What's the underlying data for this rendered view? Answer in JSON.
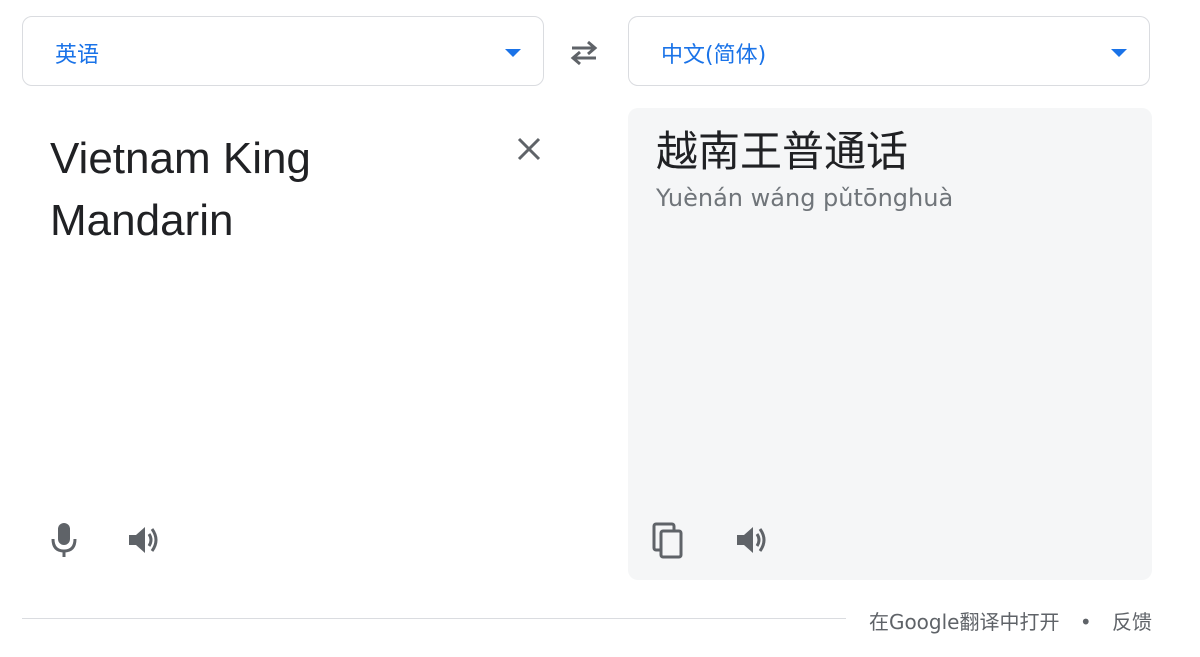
{
  "source_language": {
    "label": "英语"
  },
  "target_language": {
    "label": "中文(简体)"
  },
  "source": {
    "text": "Vietnam King Mandarin"
  },
  "translation": {
    "text": "越南王普通话",
    "romanization": "Yuènán wáng pǔtōnghuà"
  },
  "footer": {
    "open_link": "在Google翻译中打开",
    "separator": "•",
    "feedback_link": "反馈"
  },
  "icons": {
    "dropdown": "caret-down-icon",
    "swap": "swap-icon",
    "clear": "close-icon",
    "microphone": "microphone-icon",
    "speaker": "speaker-icon",
    "copy": "copy-icon"
  },
  "colors": {
    "accent": "#1a73e8",
    "text": "#202124",
    "muted": "#70757a",
    "panel_bg": "#f5f6f7",
    "border": "#dadce0"
  }
}
